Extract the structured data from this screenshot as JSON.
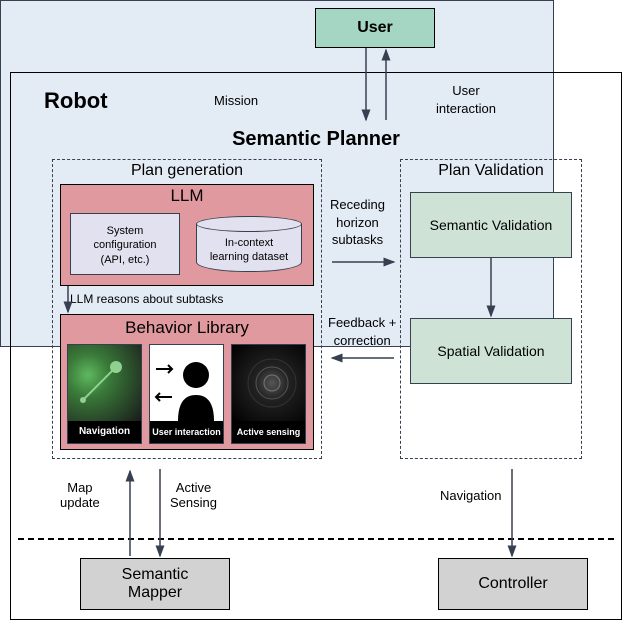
{
  "user": {
    "label": "User"
  },
  "robot": {
    "title": "Robot"
  },
  "arrows": {
    "mission": "Mission",
    "user_interaction": "User\ninteraction"
  },
  "planner": {
    "title": "Semantic Planner",
    "plan_generation": {
      "title": "Plan generation",
      "llm": {
        "title": "LLM",
        "sysconfig": "System\nconfiguration\n(API, etc.)",
        "dataset": "In-context\nlearning dataset"
      },
      "reason_note": "LLM reasons about subtasks",
      "behavior": {
        "title": "Behavior Library",
        "navigation": "Navigation",
        "user_interaction": "User interaction",
        "active_sensing": "Active sensing"
      }
    },
    "exchange": {
      "receding": "Receding\nhorizon\nsubtasks",
      "feedback": "Feedback +\ncorrection"
    },
    "plan_validation": {
      "title": "Plan Validation",
      "semantic": "Semantic Validation",
      "spatial": "Spatial Validation"
    }
  },
  "below": {
    "map_update": "Map\nupdate",
    "active_sensing": "Active\nSensing",
    "navigation": "Navigation"
  },
  "bottom": {
    "mapper": "Semantic\nMapper",
    "controller": "Controller"
  }
}
